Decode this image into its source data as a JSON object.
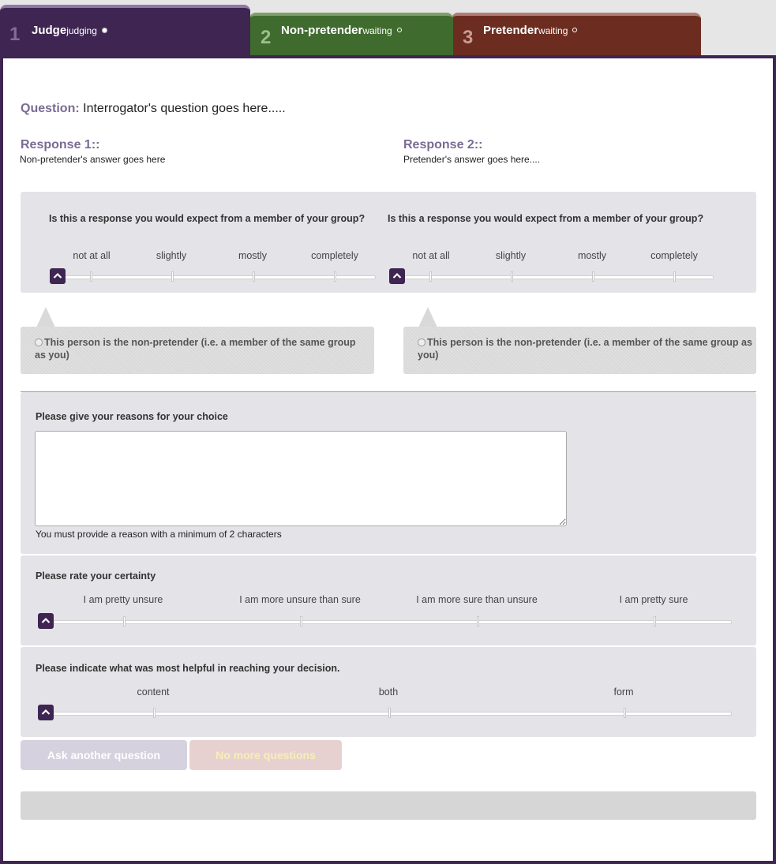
{
  "tabs": [
    {
      "num": "1",
      "title": "Judge",
      "status": "judging"
    },
    {
      "num": "2",
      "title": "Non-pretender",
      "status": "waiting"
    },
    {
      "num": "3",
      "title": "Pretender",
      "status": "waiting"
    }
  ],
  "question": {
    "label": "Question:",
    "text": "Interrogator's question goes here....."
  },
  "responses": [
    {
      "heading": "Response 1::",
      "text": "Non-pretender's answer goes here"
    },
    {
      "heading": "Response 2::",
      "text": "Pretender's answer goes here...."
    }
  ],
  "expect_scale": {
    "question": "Is this a response you would expect from a member of your group?",
    "labels": [
      "not at all",
      "slightly",
      "mostly",
      "completely"
    ]
  },
  "choice": {
    "option_text": "This person is the non-pretender (i.e. a member of the same group as you)"
  },
  "reasons": {
    "title": "Please give your reasons for your choice",
    "value": "",
    "helper": "You must provide a reason with a minimum of 2 characters"
  },
  "certainty": {
    "title": "Please rate your certainty",
    "labels": [
      "I am pretty unsure",
      "I am more unsure than sure",
      "I am more sure than unsure",
      "I am pretty sure"
    ]
  },
  "helpful": {
    "title": "Please indicate what was most helpful in reaching your decision.",
    "labels": [
      "content",
      "both",
      "form"
    ]
  },
  "buttons": {
    "ask": "Ask another question",
    "no_more": "No more questions"
  },
  "colors": {
    "judge": "#3e2552",
    "non_pretender": "#3f6b2e",
    "pretender": "#6c2d20",
    "heading": "#7a6b93"
  },
  "icons": {
    "slider_handle": "chevron-up-icon",
    "active_status": "filled-dot-icon",
    "waiting_status": "hollow-dot-icon"
  }
}
